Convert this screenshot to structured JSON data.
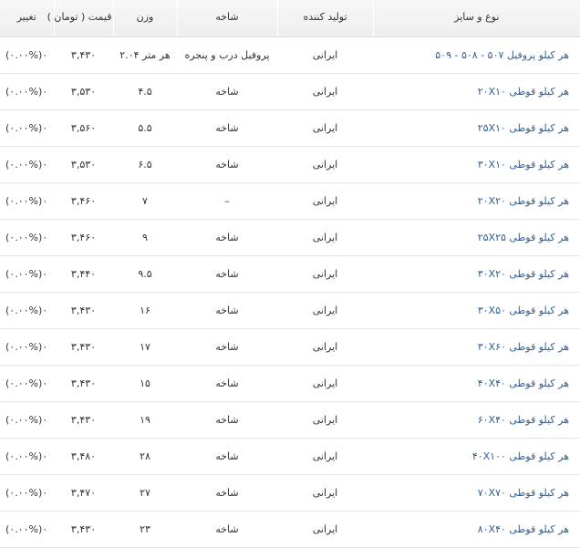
{
  "headers": {
    "name": "نوع و سایز",
    "producer": "تولید کننده",
    "branch": "شاخه",
    "weight": "وزن",
    "price": "قیمت ( تومان )",
    "change": "تغییر"
  },
  "rows": [
    {
      "name": "هر کیلو پروفیل ۵۰۷ - ۵۰۸ - ۵۰۹",
      "producer": "ایرانی",
      "branch": "پروفیل درب و پنجره",
      "weight": "هر متر ۲.۰۴",
      "price": "۳,۴۳۰",
      "change": "(۰.۰۰%)۰"
    },
    {
      "name": "هر کیلو قوطی ۲۰X۱۰",
      "producer": "ایرانی",
      "branch": "شاخه",
      "weight": "۴.۵",
      "price": "۳,۵۳۰",
      "change": "(۰.۰۰%)۰"
    },
    {
      "name": "هر کیلو قوطی ۲۵X۱۰",
      "producer": "ایرانی",
      "branch": "شاخه",
      "weight": "۵.۵",
      "price": "۳,۵۶۰",
      "change": "(۰.۰۰%)۰"
    },
    {
      "name": "هر کیلو قوطی ۳۰X۱۰",
      "producer": "ایرانی",
      "branch": "شاخه",
      "weight": "۶.۵",
      "price": "۳,۵۳۰",
      "change": "(۰.۰۰%)۰"
    },
    {
      "name": "هر کیلو قوطی ۲۰X۲۰",
      "producer": "ایرانی",
      "branch": "–",
      "weight": "۷",
      "price": "۳,۴۶۰",
      "change": "(۰.۰۰%)۰"
    },
    {
      "name": "هر کیلو قوطی ۲۵X۲۵",
      "producer": "ایرانی",
      "branch": "شاخه",
      "weight": "۹",
      "price": "۳,۴۶۰",
      "change": "(۰.۰۰%)۰"
    },
    {
      "name": "هر کیلو قوطی ۳۰X۲۰",
      "producer": "ایرانی",
      "branch": "شاخه",
      "weight": "۹.۵",
      "price": "۳,۴۴۰",
      "change": "(۰.۰۰%)۰"
    },
    {
      "name": "هر کیلو قوطی ۳۰X۵۰",
      "producer": "ایرانی",
      "branch": "شاخه",
      "weight": "۱۶",
      "price": "۳,۴۳۰",
      "change": "(۰.۰۰%)۰"
    },
    {
      "name": "هر کیلو قوطی ۳۰X۶۰",
      "producer": "ایرانی",
      "branch": "شاخه",
      "weight": "۱۷",
      "price": "۳,۴۳۰",
      "change": "(۰.۰۰%)۰"
    },
    {
      "name": "هر کیلو قوطی ۴۰X۴۰",
      "producer": "ایرانی",
      "branch": "شاخه",
      "weight": "۱۵",
      "price": "۳,۴۳۰",
      "change": "(۰.۰۰%)۰"
    },
    {
      "name": "هر کیلو قوطی ۶۰X۴۰",
      "producer": "ایرانی",
      "branch": "شاخه",
      "weight": "۱۹",
      "price": "۳,۴۳۰",
      "change": "(۰.۰۰%)۰"
    },
    {
      "name": "هر کیلو قوطی ۴۰X۱۰۰",
      "producer": "ایرانی",
      "branch": "شاخه",
      "weight": "۲۸",
      "price": "۳,۴۸۰",
      "change": "(۰.۰۰%)۰"
    },
    {
      "name": "هر کیلو قوطی ۷۰X۷۰",
      "producer": "ایرانی",
      "branch": "شاخه",
      "weight": "۲۷",
      "price": "۳,۴۷۰",
      "change": "(۰.۰۰%)۰"
    },
    {
      "name": "هر کیلو قوطی ۸۰X۴۰",
      "producer": "ایرانی",
      "branch": "شاخه",
      "weight": "۲۳",
      "price": "۳,۴۳۰",
      "change": "(۰.۰۰%)۰"
    }
  ],
  "colors": {
    "link": "#2f5f98",
    "text": "#333333",
    "header_bg": "#f2f2f2",
    "row_border": "#e4e4e4"
  }
}
